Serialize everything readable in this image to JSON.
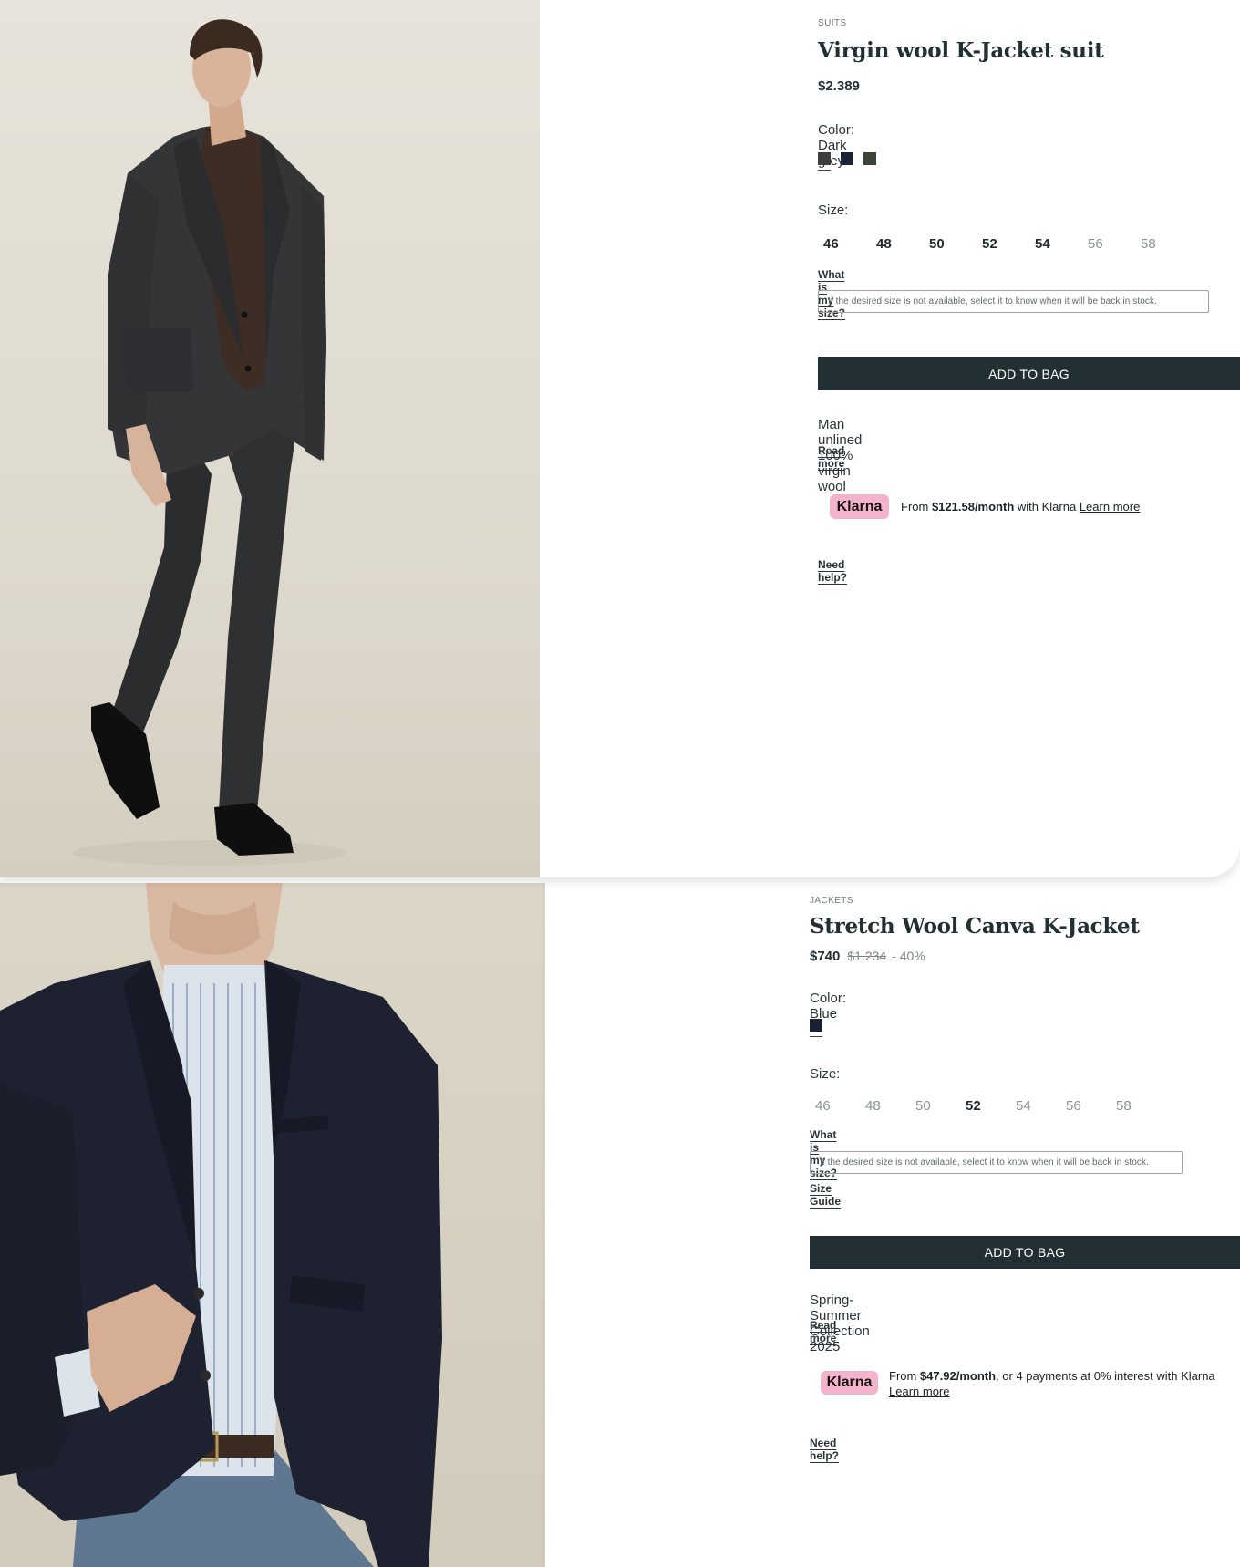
{
  "products": [
    {
      "category": "SUITS",
      "title": "Virgin wool K-Jacket suit",
      "price": "$2.389",
      "color_label": "Color: Dark grey",
      "swatches": [
        "#3a3d3c",
        "#1d2336",
        "#3b4538"
      ],
      "size_label": "Size:",
      "sizes": [
        "46",
        "48",
        "50",
        "52",
        "54",
        "56",
        "58"
      ],
      "sizes_available": [
        true,
        true,
        true,
        true,
        true,
        false,
        false
      ],
      "what_size_link": "What is my size?",
      "notice": "If the desired size is not available, select it to know when it will be back in stock.",
      "add_to_bag": "ADD TO BAG",
      "description": "Man unlined 100% virgin wool",
      "read_more": "Read more",
      "klarna": {
        "badge": "Klarna",
        "prefix": "From ",
        "amount": "$121.58/month",
        "suffix": " with Klarna ",
        "learn_more": "Learn more"
      },
      "need_help": "Need help?"
    },
    {
      "category": "JACKETS",
      "title": "Stretch Wool Canva K-Jacket",
      "price": "$740",
      "old_price": "$1.234",
      "discount": "- 40%",
      "color_label": "Color: Blue",
      "swatches": [
        "#1b2033"
      ],
      "size_label": "Size:",
      "sizes": [
        "46",
        "48",
        "50",
        "52",
        "54",
        "56",
        "58"
      ],
      "sizes_available": [
        false,
        false,
        false,
        true,
        false,
        false,
        false
      ],
      "what_size_link": "What is my size?",
      "notice": "If the desired size is not available, select it to know when it will be back in stock.",
      "size_guide": "Size Guide",
      "add_to_bag": "ADD TO BAG",
      "description": "Spring-Summer Collection 2025",
      "read_more": "Read more",
      "klarna": {
        "badge": "Klarna",
        "prefix": "From ",
        "amount": "$47.92/month",
        "suffix": ", or 4 payments at 0% interest with Klarna",
        "learn_more": "Learn more"
      },
      "need_help": "Need help?"
    }
  ]
}
